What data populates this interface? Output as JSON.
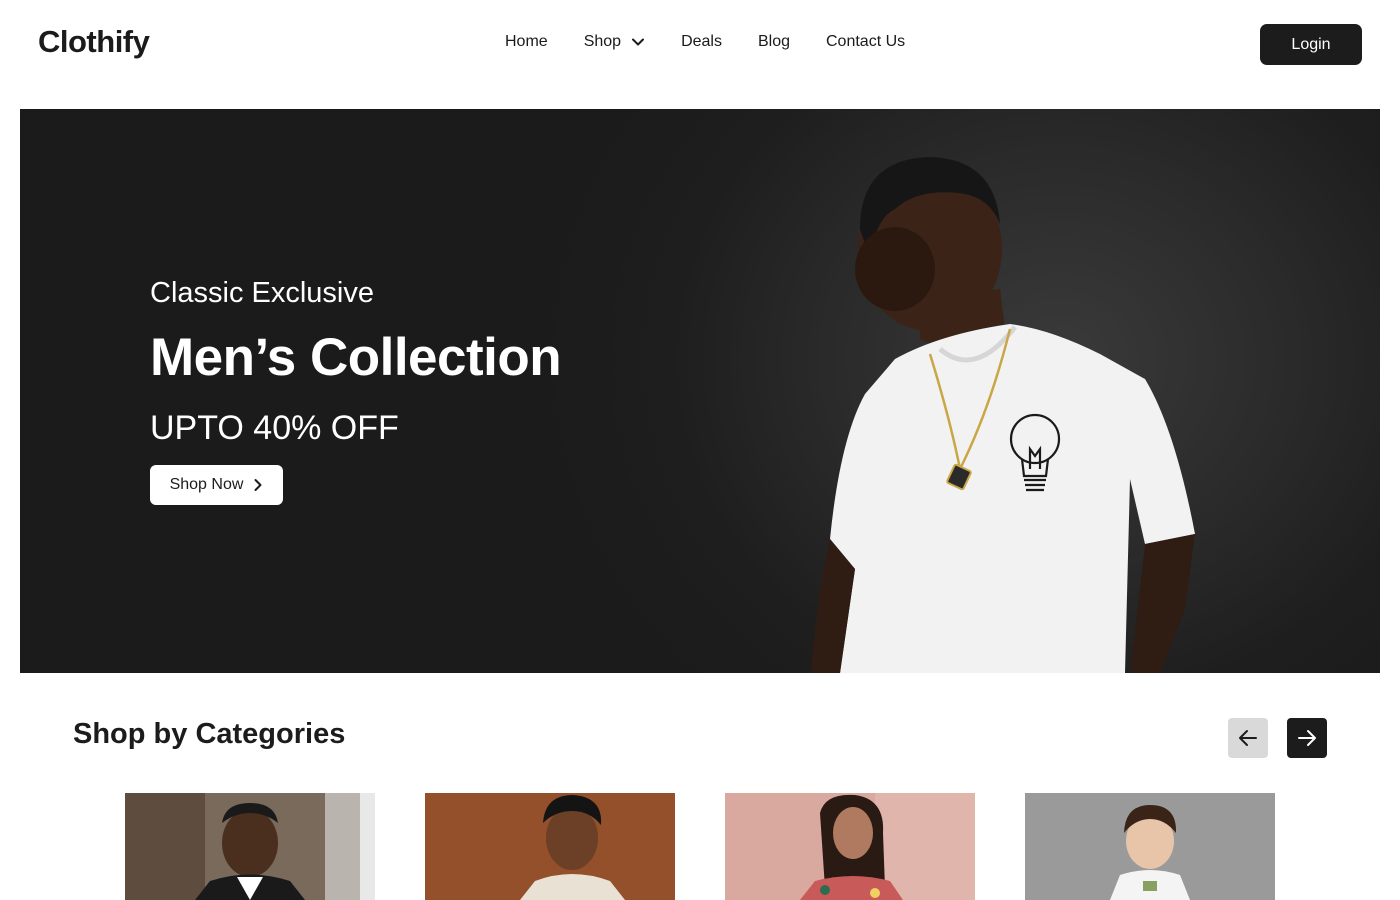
{
  "header": {
    "logo": "Clothify",
    "nav": [
      {
        "label": "Home"
      },
      {
        "label": "Shop",
        "has_dropdown": true
      },
      {
        "label": "Deals"
      },
      {
        "label": "Blog"
      },
      {
        "label": "Contact Us"
      }
    ],
    "login_label": "Login"
  },
  "hero": {
    "subtitle": "Classic Exclusive",
    "title": "Men’s Collection",
    "offer": "UPTO 40% OFF",
    "cta_label": "Shop Now",
    "cta_icon": "chevron-right-icon"
  },
  "categories": {
    "title": "Shop by Categories",
    "prev_icon": "arrow-left-icon",
    "next_icon": "arrow-right-icon",
    "cards": [
      {
        "image": "man-in-suit"
      },
      {
        "image": "man-in-hoodie"
      },
      {
        "image": "woman-floral-dress"
      },
      {
        "image": "boy-white-tshirt"
      }
    ]
  },
  "colors": {
    "dark": "#1c1c1c",
    "hero_bg": "#1e1e1e",
    "prev_btn_bg": "#d9d9d9",
    "white": "#ffffff"
  }
}
